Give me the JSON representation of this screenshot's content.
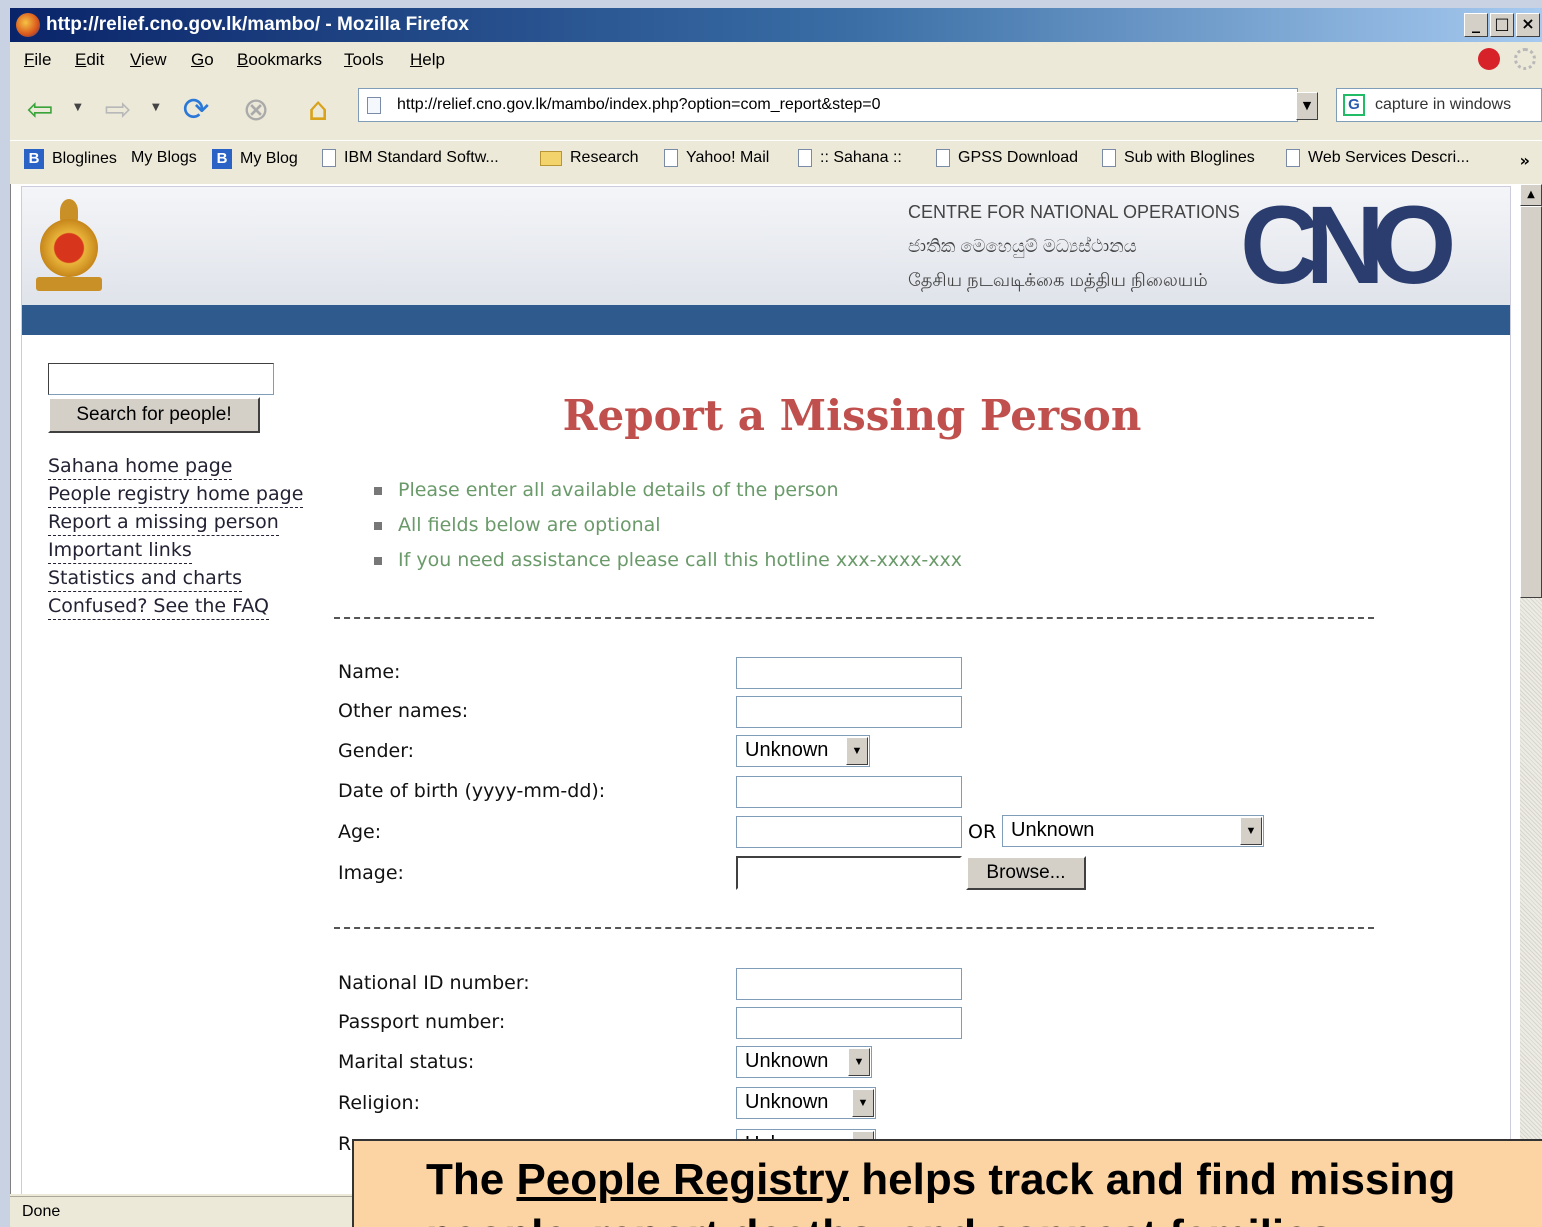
{
  "window": {
    "title": "http://relief.cno.gov.lk/mambo/ - Mozilla Firefox",
    "controls": [
      "_",
      "□",
      "×"
    ]
  },
  "menu": [
    "File",
    "Edit",
    "View",
    "Go",
    "Bookmarks",
    "Tools",
    "Help"
  ],
  "toolbar": {
    "url": "http://relief.cno.gov.lk/mambo/index.php?option=com_report&step=0",
    "search_text": "capture in windows",
    "icons": [
      "back-icon",
      "forward-icon",
      "reload-icon",
      "stop-icon",
      "home-icon"
    ]
  },
  "bookmarks": [
    {
      "label": "Bloglines",
      "icon": "B"
    },
    {
      "label": "My Blogs",
      "icon": ""
    },
    {
      "label": "My Blog",
      "icon": "B"
    },
    {
      "label": "IBM Standard Softw...",
      "icon": "page"
    },
    {
      "label": "Research",
      "icon": "folder"
    },
    {
      "label": "Yahoo! Mail",
      "icon": "page"
    },
    {
      "label": ":: Sahana ::",
      "icon": "page"
    },
    {
      "label": "GPSS Download",
      "icon": "page"
    },
    {
      "label": "Sub with Bloglines",
      "icon": "page"
    },
    {
      "label": "Web Services Descri...",
      "icon": "page"
    }
  ],
  "bookmarks_more": "»",
  "banner": {
    "line1": "CENTRE FOR NATIONAL OPERATIONS",
    "line2": "ජාතික මෙහෙයුම් මධ්‍යස්ථානය",
    "line3": "தேசிய நடவடிக்கை மத்திய நிலையம்",
    "logo": "CNO"
  },
  "sidebar": {
    "search_button": "Search for people!",
    "links": [
      "Sahana home page",
      "People registry home page",
      "Report a missing person",
      "Important links",
      "Statistics and charts",
      "Confused? See the FAQ"
    ]
  },
  "main": {
    "title": "Report a Missing Person",
    "notes": [
      "Please enter all available details of the person",
      "All fields below are optional",
      "If you need assistance please call this hotline xxx-xxxx-xxx"
    ]
  },
  "form": {
    "name_label": "Name:",
    "other_names_label": "Other names:",
    "gender_label": "Gender:",
    "gender_value": "Unknown",
    "dob_label": "Date of birth (yyyy-mm-dd):",
    "age_label": "Age:",
    "or_label": "OR",
    "age_range_value": "Unknown",
    "image_label": "Image:",
    "browse_label": "Browse...",
    "nid_label": "National ID number:",
    "passport_label": "Passport number:",
    "marital_label": "Marital status:",
    "marital_value": "Unknown",
    "religion_label": "Religion:",
    "religion_value": "Unknown",
    "race_label": "Race:",
    "race_value": "Unknown"
  },
  "status": "Done",
  "caption": {
    "pre": "The ",
    "link": "People Registry",
    "post": " helps track and find missing",
    "line2": "people, report deaths, and connect families"
  }
}
